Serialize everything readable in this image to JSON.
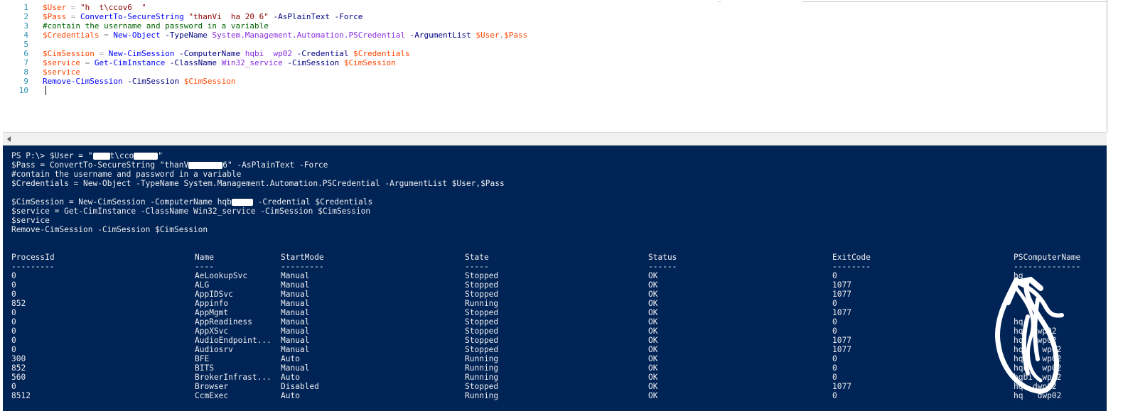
{
  "editor": {
    "lines": [
      {
        "num": "1",
        "tokens": [
          {
            "c": "var",
            "t": "$User"
          },
          {
            "c": "op",
            "t": " = "
          },
          {
            "c": "str",
            "t": "\"h  t\\ccov6  \""
          }
        ]
      },
      {
        "num": "2",
        "tokens": [
          {
            "c": "var",
            "t": "$Pass"
          },
          {
            "c": "op",
            "t": " = "
          },
          {
            "c": "cmd",
            "t": "ConvertTo-SecureString"
          },
          {
            "c": "op",
            "t": " "
          },
          {
            "c": "str",
            "t": "\"thanVi  ha 20 6\""
          },
          {
            "c": "op",
            "t": " "
          },
          {
            "c": "par",
            "t": "-AsPlainText"
          },
          {
            "c": "op",
            "t": " "
          },
          {
            "c": "par",
            "t": "-Force"
          }
        ]
      },
      {
        "num": "3",
        "tokens": [
          {
            "c": "cmt",
            "t": "#contain the username and password in a variable"
          }
        ]
      },
      {
        "num": "4",
        "tokens": [
          {
            "c": "var",
            "t": "$Credentials"
          },
          {
            "c": "op",
            "t": " = "
          },
          {
            "c": "cmd",
            "t": "New-Object"
          },
          {
            "c": "op",
            "t": " "
          },
          {
            "c": "par",
            "t": "-TypeName"
          },
          {
            "c": "op",
            "t": " "
          },
          {
            "c": "typ",
            "t": "System.Management.Automation.PSCredential"
          },
          {
            "c": "op",
            "t": " "
          },
          {
            "c": "par",
            "t": "-ArgumentList"
          },
          {
            "c": "op",
            "t": " "
          },
          {
            "c": "var",
            "t": "$User"
          },
          {
            "c": "op",
            "t": ","
          },
          {
            "c": "var",
            "t": "$Pass"
          }
        ]
      },
      {
        "num": "5",
        "tokens": []
      },
      {
        "num": "6",
        "tokens": [
          {
            "c": "var",
            "t": "$CimSession"
          },
          {
            "c": "op",
            "t": " = "
          },
          {
            "c": "cmd",
            "t": "New-CimSession"
          },
          {
            "c": "op",
            "t": " "
          },
          {
            "c": "par",
            "t": "-ComputerName"
          },
          {
            "c": "op",
            "t": " "
          },
          {
            "c": "typ",
            "t": "hqbi  wp02"
          },
          {
            "c": "op",
            "t": " "
          },
          {
            "c": "par",
            "t": "-Credential"
          },
          {
            "c": "op",
            "t": " "
          },
          {
            "c": "var",
            "t": "$Credentials"
          }
        ]
      },
      {
        "num": "7",
        "tokens": [
          {
            "c": "var",
            "t": "$service"
          },
          {
            "c": "op",
            "t": " = "
          },
          {
            "c": "cmd",
            "t": "Get-CimInstance"
          },
          {
            "c": "op",
            "t": " "
          },
          {
            "c": "par",
            "t": "-ClassName"
          },
          {
            "c": "op",
            "t": " "
          },
          {
            "c": "typ",
            "t": "Win32_service"
          },
          {
            "c": "op",
            "t": " "
          },
          {
            "c": "par",
            "t": "-CimSession"
          },
          {
            "c": "op",
            "t": " "
          },
          {
            "c": "var",
            "t": "$CimSession"
          }
        ]
      },
      {
        "num": "8",
        "tokens": [
          {
            "c": "var",
            "t": "$service"
          }
        ]
      },
      {
        "num": "9",
        "tokens": [
          {
            "c": "cmd",
            "t": "Remove-CimSession"
          },
          {
            "c": "op",
            "t": " "
          },
          {
            "c": "par",
            "t": "-CimSession"
          },
          {
            "c": "op",
            "t": " "
          },
          {
            "c": "var",
            "t": "$CimSession"
          }
        ]
      },
      {
        "num": "10",
        "tokens": []
      }
    ]
  },
  "console": {
    "echo": [
      "PS P:\\> $User = \"",
      "t\\cco",
      "\"",
      "$Pass = ConvertTo-SecureString \"thanV",
      "6\" -AsPlainText -Force",
      "#contain the username and password in a variable",
      "$Credentials = New-Object -TypeName System.Management.Automation.PSCredential -ArgumentList $User,$Pass",
      "$CimSession = New-CimSession -ComputerName hqb",
      " -Credential $Credentials",
      "$service = Get-CimInstance -ClassName Win32_service -CimSession $CimSession",
      "$service",
      "Remove-CimSession -CimSession $CimSession"
    ],
    "columns": [
      "ProcessId",
      "Name",
      "StartMode",
      "State",
      "Status",
      "ExitCode",
      "PSComputerName"
    ],
    "underlines": [
      "---------",
      "----",
      "---------",
      "-----",
      "------",
      "--------",
      "--------------"
    ],
    "rows": [
      [
        "0",
        "AeLookupSvc",
        "Manual",
        "Stopped",
        "OK",
        "0",
        "hq"
      ],
      [
        "0",
        "ALG",
        "Manual",
        "Stopped",
        "OK",
        "1077",
        ""
      ],
      [
        "0",
        "AppIDSvc",
        "Manual",
        "Stopped",
        "OK",
        "1077",
        ""
      ],
      [
        "852",
        "Appinfo",
        "Manual",
        "Running",
        "OK",
        "0",
        ""
      ],
      [
        "0",
        "AppMgmt",
        "Manual",
        "Stopped",
        "OK",
        "1077",
        ""
      ],
      [
        "0",
        "AppReadiness",
        "Manual",
        "Stopped",
        "OK",
        "0",
        "hq"
      ],
      [
        "0",
        "AppXSvc",
        "Manual",
        "Stopped",
        "OK",
        "0",
        "hq  dwp02"
      ],
      [
        "0",
        "AudioEndpoint...",
        "Manual",
        "Stopped",
        "OK",
        "1077",
        "hq  dwp02"
      ],
      [
        "0",
        "Audiosrv",
        "Manual",
        "Stopped",
        "OK",
        "1077",
        "hqb   wp02"
      ],
      [
        "300",
        "BFE",
        "Auto",
        "Running",
        "OK",
        "0",
        "hqb   wp02"
      ],
      [
        "852",
        "BITS",
        "Manual",
        "Running",
        "OK",
        "0",
        "hqb   wp02"
      ],
      [
        "560",
        "BrokerInfrast...",
        "Auto",
        "Running",
        "OK",
        "0",
        "hqbi  wp02"
      ],
      [
        "0",
        "Browser",
        "Disabled",
        "Stopped",
        "OK",
        "1077",
        "hq  dwp02"
      ],
      [
        "8512",
        "CcmExec",
        "Auto",
        "Running",
        "OK",
        "0",
        "hq   dwp02"
      ]
    ]
  }
}
